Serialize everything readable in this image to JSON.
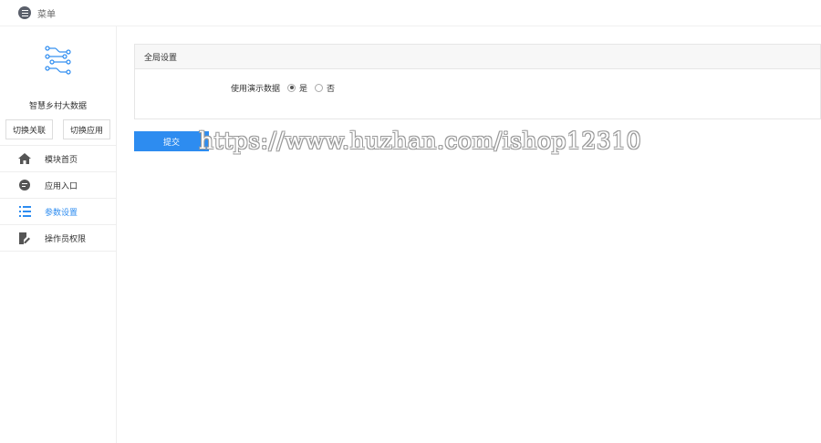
{
  "topbar": {
    "menu_label": "菜单",
    "menu_icon": "list-circle-icon"
  },
  "sidebar": {
    "app_name": "智慧乡村大数据",
    "logo_icon": "circuit-logo-icon",
    "switch_link_label": "切换关联",
    "switch_app_label": "切换应用",
    "items": [
      {
        "label": "模块首页",
        "icon": "home-icon",
        "active": false
      },
      {
        "label": "应用入口",
        "icon": "chat-icon",
        "active": false
      },
      {
        "label": "参数设置",
        "icon": "list-icon",
        "active": true
      },
      {
        "label": "操作员权限",
        "icon": "edit-doc-icon",
        "active": false
      }
    ]
  },
  "panel": {
    "title": "全局设置",
    "field_label": "使用演示数据",
    "options": [
      "是",
      "否"
    ],
    "selected": "是"
  },
  "submit_label": "提交",
  "watermark": "https://www.huzhan.com/ishop12310",
  "colors": {
    "accent": "#2d8cf0"
  }
}
